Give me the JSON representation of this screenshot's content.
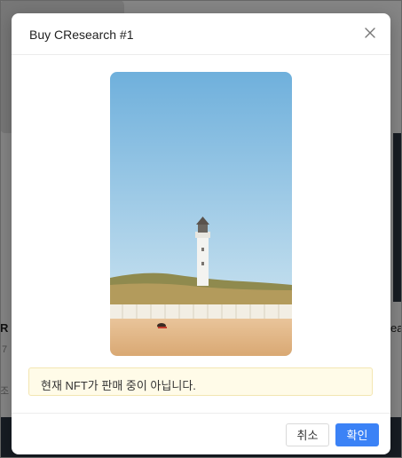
{
  "modal": {
    "title": "Buy CResearch #1",
    "notice": "현재 NFT가 판매 중이 아닙니다.",
    "cancel_label": "취소",
    "ok_label": "확인"
  },
  "background": {
    "left_snippet": "R",
    "left_number": "7",
    "left_misc": "조",
    "right_snippet": "ea"
  },
  "colors": {
    "primary": "#3b82f6",
    "notice_bg": "#fffbe8"
  }
}
